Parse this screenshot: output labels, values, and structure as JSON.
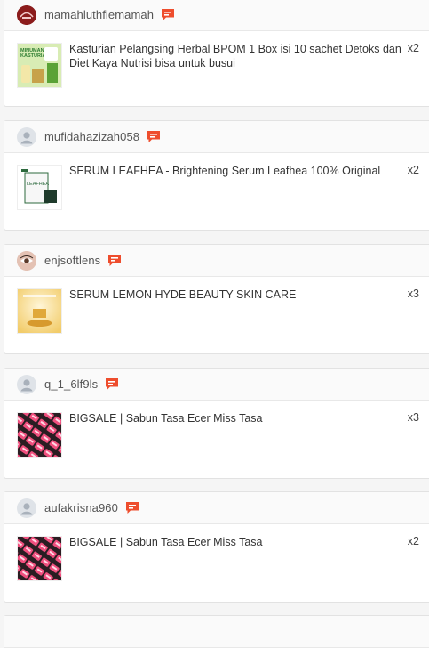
{
  "orders": [
    {
      "username": "mamahluthfiemamah",
      "avatar": "store-logo-avatar",
      "item": {
        "name": "Kasturian Pelangsing Herbal BPOM 1 Box isi 10 sachet Detoks dan Diet Kaya Nutrisi bisa untuk busui",
        "qty": "x2",
        "thumb_label_line1": "MINUMAN",
        "thumb_label_line2": "KASTURIAN",
        "thumb": "herbal-drink-thumbnail"
      }
    },
    {
      "username": "mufidahazizah058",
      "avatar": "default-user-avatar",
      "item": {
        "name": "SERUM LEAFHEA - Brightening Serum Leafhea 100% Original",
        "qty": "x2",
        "thumb_label": "LEAFHEA",
        "thumb": "serum-box-thumbnail"
      }
    },
    {
      "username": "enjsoftlens",
      "avatar": "eye-photo-avatar",
      "item": {
        "name": "SERUM LEMON HYDE BEAUTY SKIN CARE",
        "qty": "x3",
        "thumb": "lemon-serum-thumbnail"
      }
    },
    {
      "username": "q_1_6lf9ls",
      "avatar": "default-user-avatar",
      "item": {
        "name": "BIGSALE | Sabun Tasa Ecer Miss Tasa",
        "qty": "x3",
        "thumb": "soap-pattern-thumbnail"
      }
    },
    {
      "username": "aufakrisna960",
      "avatar": "default-user-avatar",
      "item": {
        "name": "BIGSALE | Sabun Tasa Ecer Miss Tasa",
        "qty": "x2",
        "thumb": "soap-pattern-thumbnail"
      }
    }
  ],
  "colors": {
    "chat_icon": "#ee4d2d",
    "border": "#e2e2e2",
    "header_bg": "#fafafa"
  }
}
